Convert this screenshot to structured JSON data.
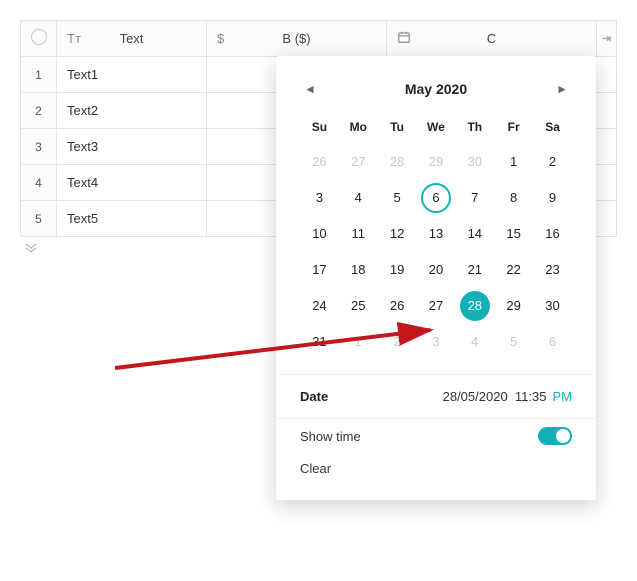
{
  "table": {
    "columns": {
      "a": "Text",
      "b": "B ($)",
      "c": "C"
    },
    "rows": [
      "Text1",
      "Text2",
      "Text3",
      "Text4",
      "Text5"
    ],
    "rownums": [
      "1",
      "2",
      "3",
      "4",
      "5"
    ]
  },
  "datepicker": {
    "title": "May 2020",
    "weekdays": [
      "Su",
      "Mo",
      "Tu",
      "We",
      "Th",
      "Fr",
      "Sa"
    ],
    "weeks": [
      [
        {
          "d": "26",
          "muted": true
        },
        {
          "d": "27",
          "muted": true
        },
        {
          "d": "28",
          "muted": true
        },
        {
          "d": "29",
          "muted": true
        },
        {
          "d": "30",
          "muted": true
        },
        {
          "d": "1"
        },
        {
          "d": "2"
        }
      ],
      [
        {
          "d": "3"
        },
        {
          "d": "4"
        },
        {
          "d": "5"
        },
        {
          "d": "6",
          "today": true
        },
        {
          "d": "7"
        },
        {
          "d": "8"
        },
        {
          "d": "9"
        }
      ],
      [
        {
          "d": "10"
        },
        {
          "d": "11"
        },
        {
          "d": "12"
        },
        {
          "d": "13"
        },
        {
          "d": "14"
        },
        {
          "d": "15"
        },
        {
          "d": "16"
        }
      ],
      [
        {
          "d": "17"
        },
        {
          "d": "18"
        },
        {
          "d": "19"
        },
        {
          "d": "20"
        },
        {
          "d": "21"
        },
        {
          "d": "22"
        },
        {
          "d": "23"
        }
      ],
      [
        {
          "d": "24"
        },
        {
          "d": "25"
        },
        {
          "d": "26"
        },
        {
          "d": "27"
        },
        {
          "d": "28",
          "selected": true
        },
        {
          "d": "29"
        },
        {
          "d": "30"
        }
      ],
      [
        {
          "d": "31"
        },
        {
          "d": "1",
          "muted": true
        },
        {
          "d": "2",
          "muted": true
        },
        {
          "d": "3",
          "muted": true
        },
        {
          "d": "4",
          "muted": true
        },
        {
          "d": "5",
          "muted": true
        },
        {
          "d": "6",
          "muted": true
        }
      ]
    ],
    "date_label": "Date",
    "date_value": "28/05/2020",
    "time_value": "11:35",
    "ampm": "PM",
    "showtime_label": "Show time",
    "clear_label": "Clear"
  },
  "icons": {
    "text": "Tᴛ",
    "currency": "$",
    "calendar": "🗓"
  },
  "colors": {
    "accent": "#14b0b8",
    "arrow": "#c1171d"
  }
}
